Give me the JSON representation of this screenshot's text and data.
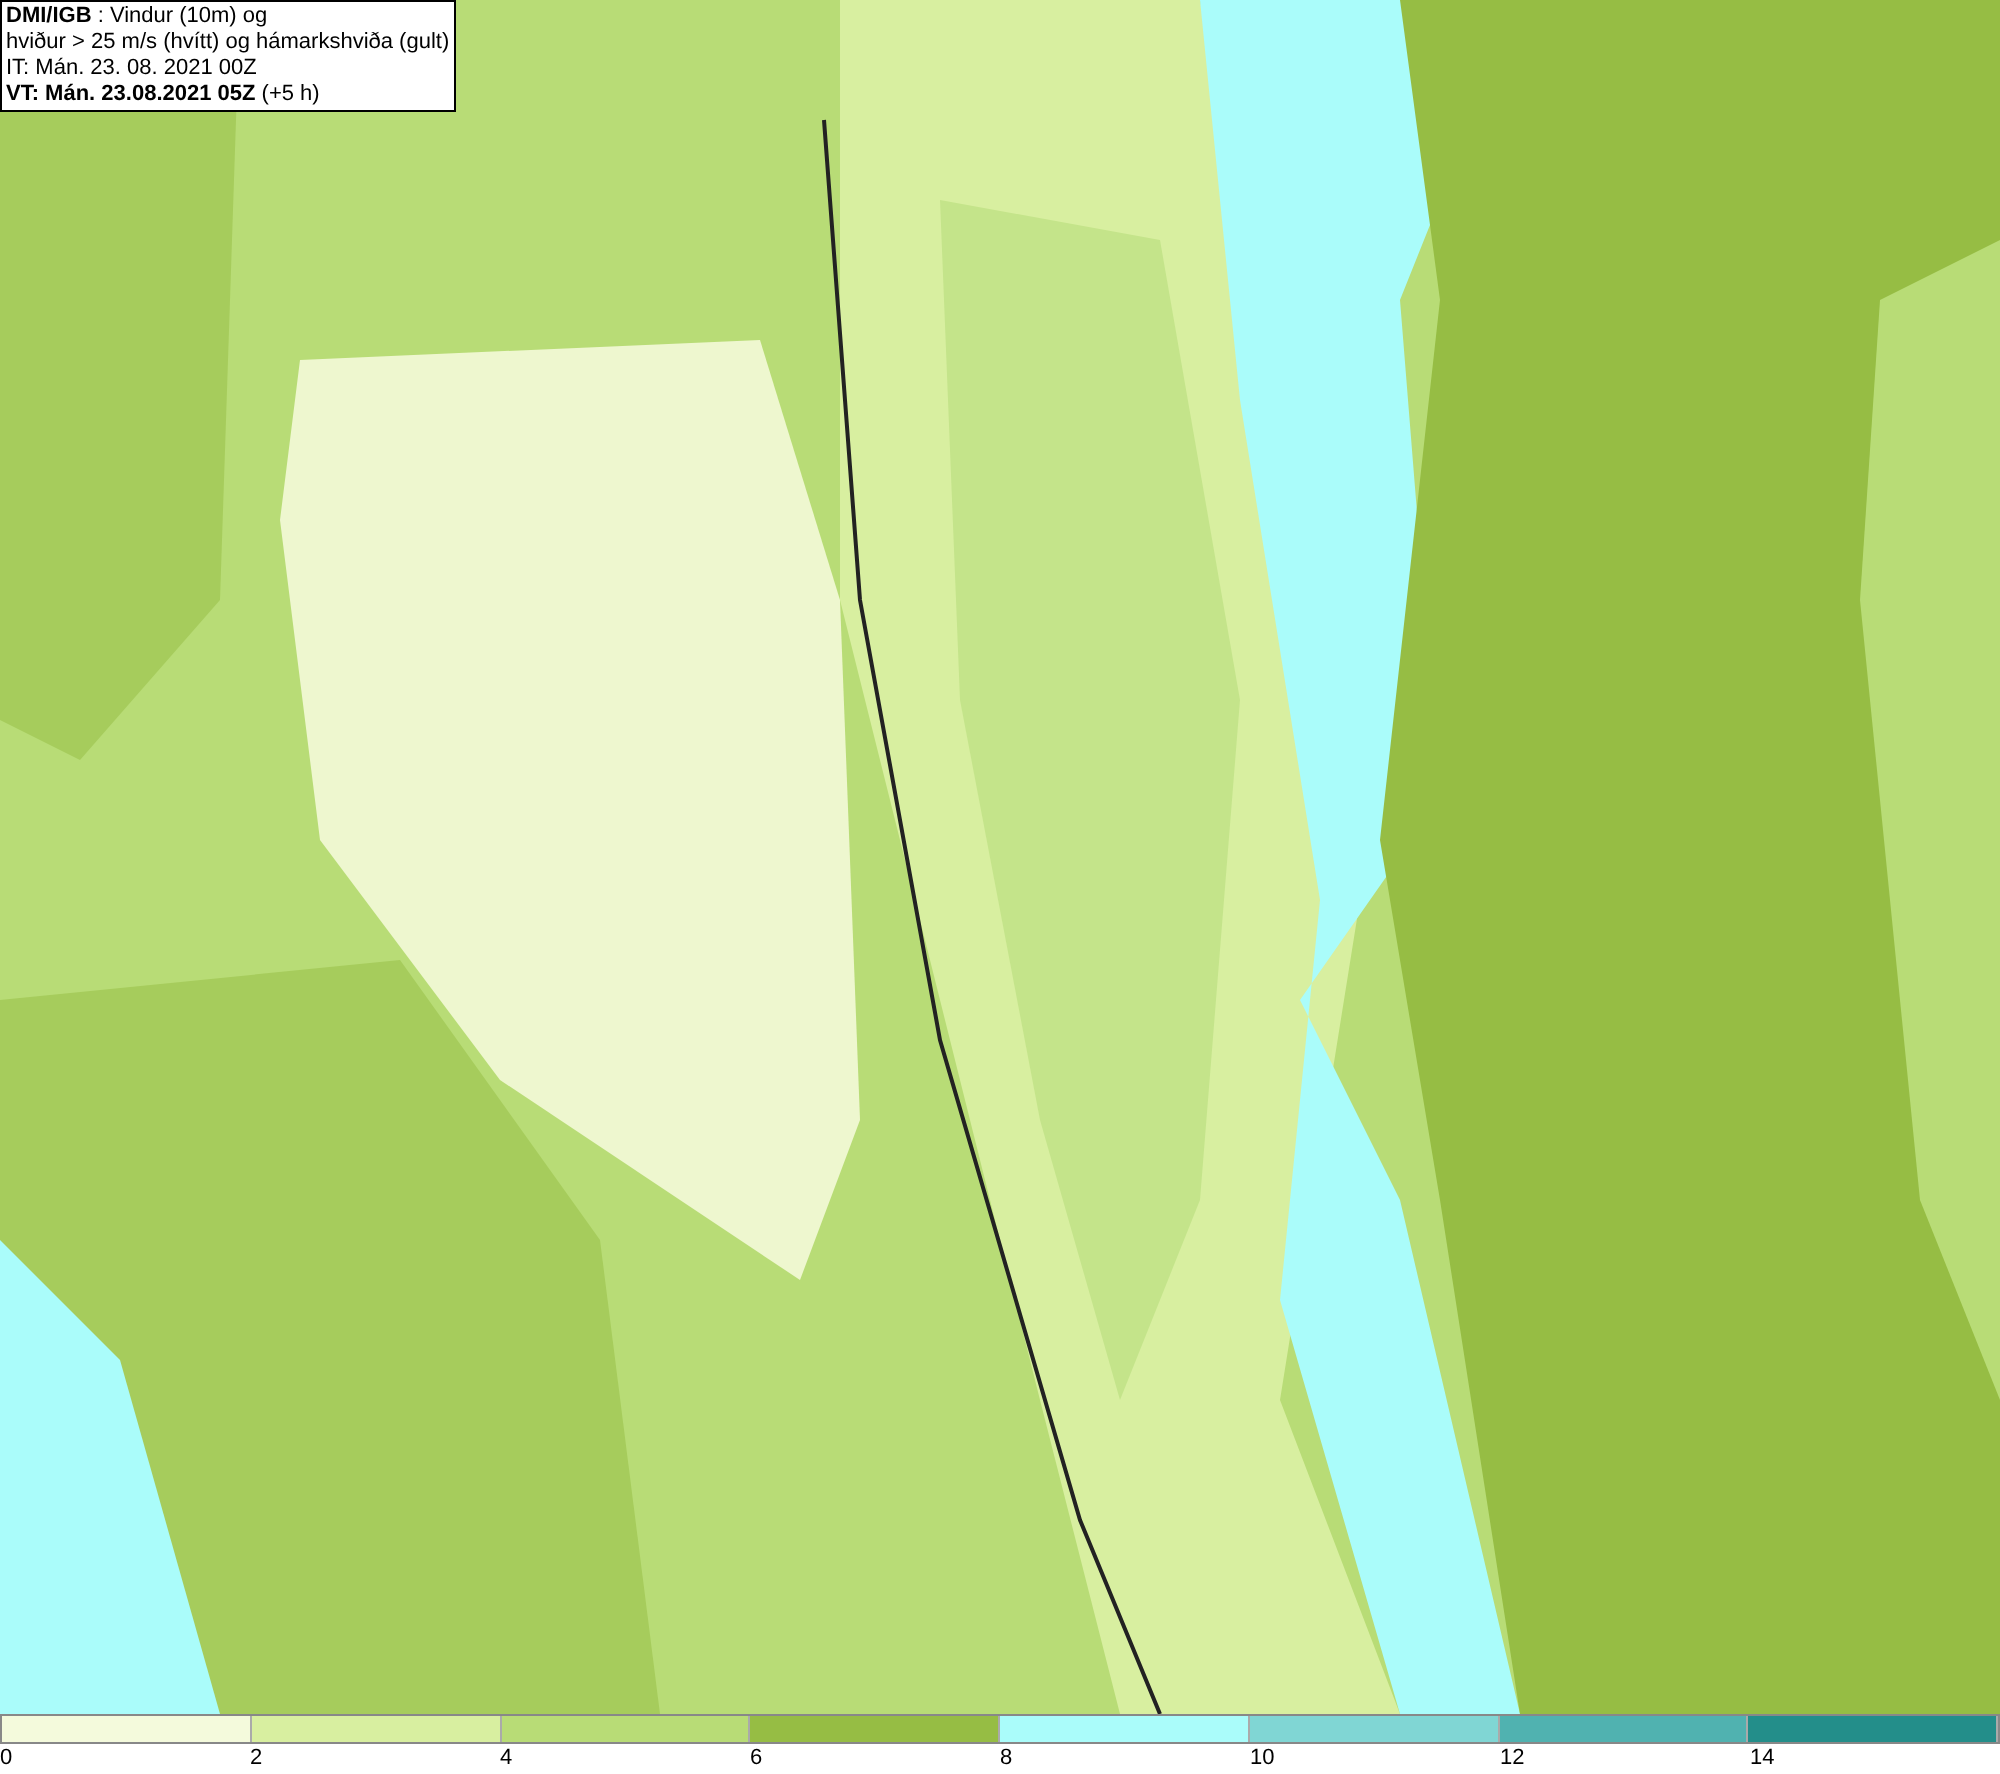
{
  "info_box": {
    "lines": [
      "**DMI/IGB** : Vindur (10m) og",
      "hviður > 25 m/s (hvítt) og hámarkshviða (gult)",
      "IT: Mán. 23. 08. 2021 00Z",
      "**VT: Mán. 23.08.2021 05Z** (+5 h)"
    ]
  },
  "legend": {
    "segments": [
      {
        "color": "#f4fadc"
      },
      {
        "color": "#d8efa0"
      },
      {
        "color": "#b8dc76"
      },
      {
        "color": "#96bd44"
      },
      {
        "color": "#aafcfa"
      },
      {
        "color": "#80d6d4"
      },
      {
        "color": "#50b2b0"
      },
      {
        "color": "#238e8a"
      }
    ],
    "labels": [
      "0",
      "2",
      "4",
      "6",
      "8",
      "10",
      "12",
      "14"
    ]
  }
}
